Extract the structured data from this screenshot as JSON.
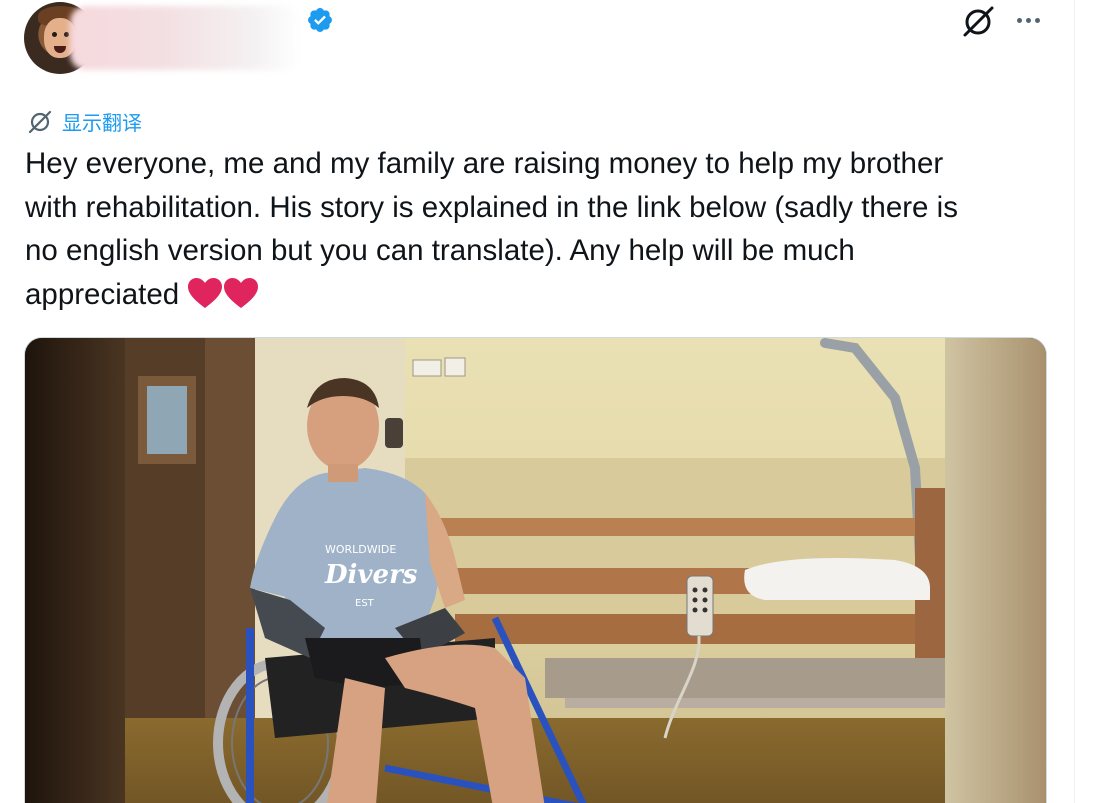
{
  "header": {
    "author_avatar": "avatar-photo",
    "author_name": "",
    "verified_icon": "verified-badge-icon",
    "grok_icon": "grok-icon",
    "more_icon": "more-options-icon"
  },
  "translate": {
    "icon": "translate-icon",
    "label": "显示翻译"
  },
  "tweet": {
    "line1": "Hey everyone, me and my family are raising money to help my brother",
    "line2": "with rehabilitation. His story is explained in the link below (sadly there is",
    "line3": "no english version but you can translate). Any help will be much",
    "line4": "appreciated",
    "emoji": [
      "red-heart",
      "red-heart"
    ]
  },
  "media": {
    "type": "photo",
    "tshirt_text": [
      "WORLDWIDE",
      "Divers",
      "EST"
    ]
  },
  "colors": {
    "accent": "#1d9bf0",
    "text": "#0f1419",
    "muted": "#536471",
    "heart": "#e0245e"
  }
}
